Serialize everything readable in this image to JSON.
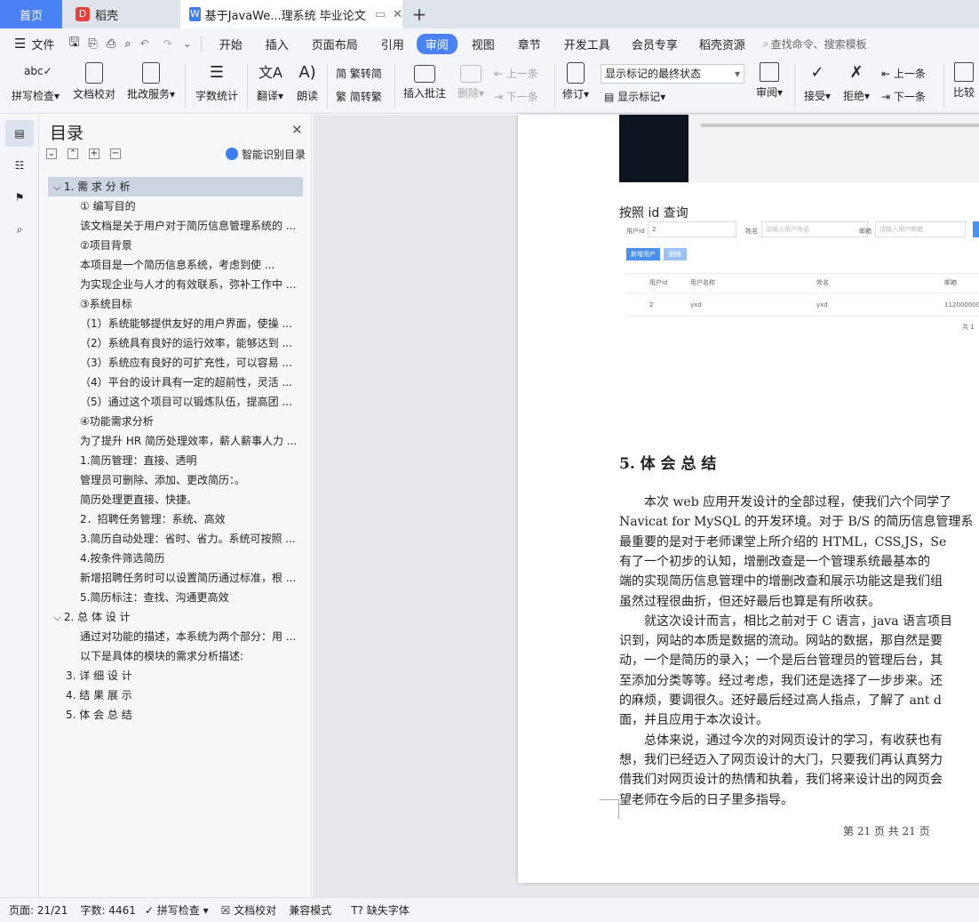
{
  "tabs": {
    "home": "首页",
    "docer": "稻壳",
    "doc": "基于JavaWe...理系统 毕业论文"
  },
  "menu": {
    "file": "文件",
    "items": [
      "开始",
      "插入",
      "页面布局",
      "引用",
      "审阅",
      "视图",
      "章节",
      "开发工具",
      "会员专享",
      "稻壳资源"
    ],
    "active": "审阅",
    "search": "查找命令、搜索模板"
  },
  "ribbon": {
    "spell": "拼写检查",
    "proof": "文档校对",
    "approve": "批改服务",
    "wordcount": "字数统计",
    "translate": "翻译",
    "read": "朗读",
    "trad": "繁转简",
    "simp": "简转繁",
    "comment": "插入批注",
    "delete": "删除",
    "prev_c": "上一条",
    "next_c": "下一条",
    "track": "修订",
    "markup_select": "显示标记的最终状态",
    "show_markup": "显示标记",
    "review": "审阅",
    "accept": "接受",
    "reject": "拒绝",
    "prev": "上一条",
    "next": "下一条",
    "compare": "比较"
  },
  "nav": {
    "title": "目录",
    "smart": "智能识别目录",
    "items": [
      {
        "text": "1. 需 求 分 析",
        "level": 0,
        "arrow": "v"
      },
      {
        "text": "① 编写目的",
        "level": 1
      },
      {
        "text": "该文档是关于用户对于简历信息管理系统的 ...",
        "level": 1
      },
      {
        "text": "②项目背景",
        "level": 1
      },
      {
        "text": "本项目是一个简历信息系统，考虑到使 ...",
        "level": 1
      },
      {
        "text": "为实现企业与人才的有效联系，弥补工作中 ...",
        "level": 1
      },
      {
        "text": "③系统目标",
        "level": 1
      },
      {
        "text": "（1）系统能够提供友好的用户界面，使操 ...",
        "level": 1
      },
      {
        "text": "（2）系统具有良好的运行效率，能够达到 ...",
        "level": 1
      },
      {
        "text": "（3）系统应有良好的可扩充性，可以容易 ...",
        "level": 1
      },
      {
        "text": "（4）平台的设计具有一定的超前性，灵活 ...",
        "level": 1
      },
      {
        "text": "（5）通过这个项目可以锻炼队伍，提高团 ...",
        "level": 1
      },
      {
        "text": "④功能需求分析",
        "level": 1
      },
      {
        "text": "为了提升 HR 简历处理效率，薪人薪事人力 ...",
        "level": 1
      },
      {
        "text": "1.简历管理：直接、透明",
        "level": 1
      },
      {
        "text": "管理员可删除、添加、更改简历：。",
        "level": 1
      },
      {
        "text": "简历处理更直接、快捷。",
        "level": 1
      },
      {
        "text": "2．招聘任务管理：系统、高效",
        "level": 1
      },
      {
        "text": "3.简历自动处理：省时、省力。系统可按照 ...",
        "level": 1
      },
      {
        "text": "4.按条件筛选简历",
        "level": 1
      },
      {
        "text": "新增招聘任务时可以设置简历通过标准，根 ...",
        "level": 1
      },
      {
        "text": "5.简历标注：查找、沟通更高效",
        "level": 1
      },
      {
        "text": "2. 总 体 设 计",
        "level": 0,
        "arrow": "v"
      },
      {
        "text": "通过对功能的描述，本系统为两个部分：用 ...",
        "level": 1
      },
      {
        "text": "以下是具体的模块的需求分析描述:",
        "level": 1
      },
      {
        "text": "3. 详 细 设 计",
        "level": 0
      },
      {
        "text": "4. 结 果 展 示",
        "level": 0
      },
      {
        "text": "5. 体 会 总 结",
        "level": 0
      }
    ]
  },
  "doc": {
    "query_heading": "按照 id 查询",
    "form": {
      "uid_label": "用户id",
      "uid_value": "2",
      "name_label": "姓名",
      "name_ph": "请输入用户姓名",
      "mail_label": "邮箱",
      "mail_ph": "请输入用户邮箱"
    },
    "btn_add": "新增用户",
    "btn_del": "删除",
    "table": {
      "headers": [
        "用户id",
        "用户名称",
        "姓名",
        "邮箱"
      ],
      "row": [
        "2",
        "yxd",
        "yxd",
        "1120000000"
      ],
      "footer": "共 1"
    },
    "section_title": "5. 体 会 总 结",
    "lines": [
      "　　本次 web 应用开发设计的全部过程，使我们六个同学了",
      "Navicat for MySQL 的开发环境。对于 B/S 的简历信息管理系",
      "最重要的是对于老师课堂上所介绍的 HTML，CSS,JS，Se",
      "有了一个初步的认知，增删改查是一个管理系统最基本的",
      "端的实现简历信息管理中的增删改查和展示功能这是我们组",
      "虽然过程很曲折，但还好最后也算是有所收获。",
      "　　就这次设计而言，相比之前对于 C 语言，java 语言项目",
      "识到，网站的本质是数据的流动。网站的数据，那自然是要",
      "动，一个是简历的录入；一个是后台管理员的管理后台，其",
      "至添加分类等等。经过考虑，我们还是选择了一步步来。还",
      "的麻烦，要调很久。还好最后经过高人指点，了解了 ant d",
      "面，并且应用于本次设计。",
      "　　总体来说，通过今次的对网页设计的学习，有收获也有",
      "想，我们已经迈入了网页设计的大门，只要我们再认真努力",
      "借我们对网页设计的热情和执着，我们将来设计出的网页会",
      "望老师在今后的日子里多指导。"
    ],
    "footer": "第 21 页 共 21 页"
  },
  "status": {
    "page": "页面: 21/21",
    "words": "字数: 4461",
    "spell": "拼写检查",
    "proof": "文档校对",
    "compat": "兼容模式",
    "font": "缺失字体"
  },
  "colors": {
    "accent": "#3d7ef7",
    "active_tab": "#4a82f5"
  }
}
